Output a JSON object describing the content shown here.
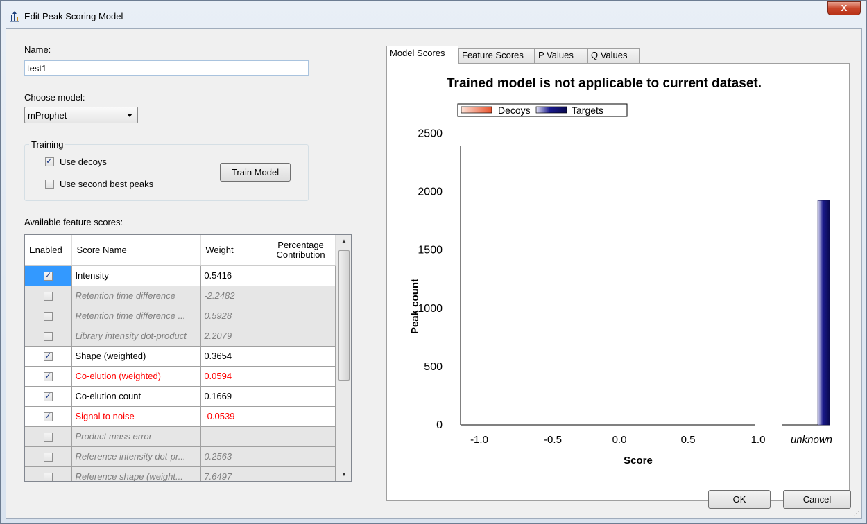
{
  "window": {
    "title": "Edit Peak Scoring Model",
    "close_label": "X"
  },
  "form": {
    "name_label": "Name:",
    "name_value": "test1",
    "model_label": "Choose model:",
    "model_value": "mProphet",
    "training_group": "Training",
    "use_decoys_label": "Use decoys",
    "use_decoys_checked": true,
    "use_second_best_label": "Use second best peaks",
    "use_second_best_checked": false,
    "train_button": "Train Model",
    "features_label": "Available feature scores:"
  },
  "grid": {
    "headers": [
      "Enabled",
      "Score Name",
      "Weight",
      "Percentage Contribution"
    ],
    "rows": [
      {
        "enabled": true,
        "name": "Intensity",
        "weight": "0.5416",
        "state": "selected"
      },
      {
        "enabled": false,
        "name": "Retention time difference",
        "weight": "-2.2482",
        "state": "disabled"
      },
      {
        "enabled": false,
        "name": "Retention time difference ...",
        "weight": "0.5928",
        "state": "disabled"
      },
      {
        "enabled": false,
        "name": "Library intensity dot-product",
        "weight": "2.2079",
        "state": "disabled"
      },
      {
        "enabled": true,
        "name": "Shape (weighted)",
        "weight": "0.3654",
        "state": "normal"
      },
      {
        "enabled": true,
        "name": "Co-elution (weighted)",
        "weight": "0.0594",
        "state": "red"
      },
      {
        "enabled": true,
        "name": "Co-elution count",
        "weight": "0.1669",
        "state": "normal"
      },
      {
        "enabled": true,
        "name": "Signal to noise",
        "weight": "-0.0539",
        "state": "red"
      },
      {
        "enabled": false,
        "name": "Product mass error",
        "weight": "",
        "state": "disabled"
      },
      {
        "enabled": false,
        "name": "Reference intensity dot-pr...",
        "weight": "0.2563",
        "state": "disabled"
      },
      {
        "enabled": false,
        "name": "Reference shape (weight...",
        "weight": "7.6497",
        "state": "disabled"
      }
    ]
  },
  "tabs": [
    "Model Scores",
    "Feature Scores",
    "P Values",
    "Q Values"
  ],
  "active_tab": "Model Scores",
  "chart_data": {
    "type": "bar",
    "title": "Trained model is not applicable to current dataset.",
    "xlabel": "Score",
    "ylabel": "Peak count",
    "x_ticks": [
      "-1.0",
      "-0.5",
      "0.0",
      "0.5",
      "1.0",
      "unknown"
    ],
    "y_ticks": [
      "0",
      "500",
      "1000",
      "1500",
      "2000",
      "2500"
    ],
    "ylim": [
      0,
      2500
    ],
    "legend_placement": "top-left",
    "series": [
      {
        "name": "Decoys",
        "color": "#e8522c",
        "values": [
          0
        ]
      },
      {
        "name": "Targets",
        "color": "#1a1a8c",
        "values": [
          1925
        ]
      }
    ],
    "categories": [
      "unknown"
    ]
  },
  "footer": {
    "ok_label": "OK",
    "cancel_label": "Cancel"
  }
}
